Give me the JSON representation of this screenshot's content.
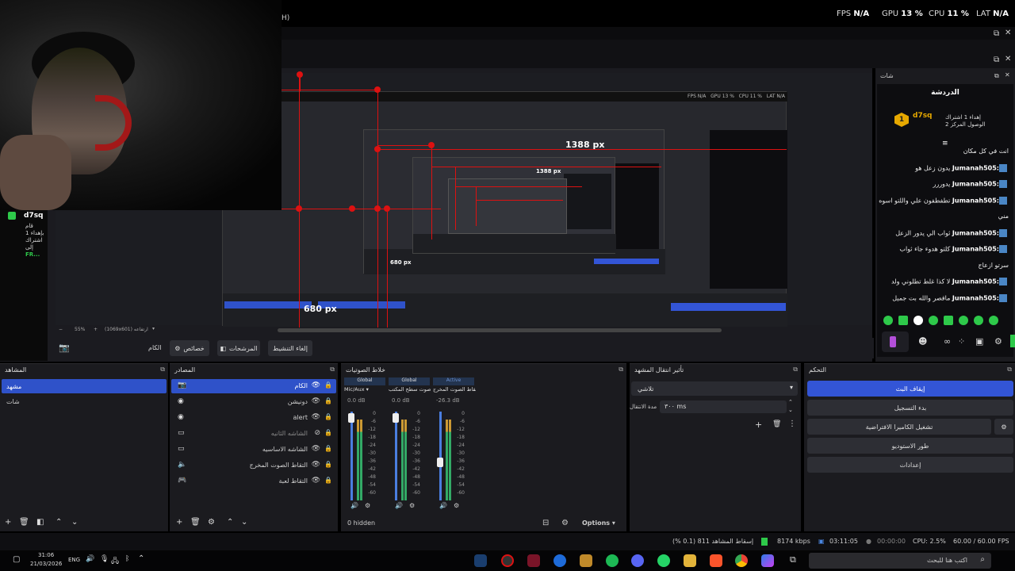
{
  "topbar": {
    "hint": "H)",
    "fps_label": "FPS",
    "fps_value": "N/A",
    "gpu_label": "GPU",
    "gpu_value": "13 %",
    "cpu_label": "CPU",
    "cpu_value": "11 %",
    "lat_label": "LAT",
    "lat_value": "N/A"
  },
  "webcam_overlay": {
    "name": "d7sq",
    "line1": "قام",
    "line2": "بإهداء 1",
    "line3": "اشتراك",
    "line4": "إلى",
    "line5": "FR..."
  },
  "preview": {
    "label_1388": "1388 px",
    "label_680": "680 px",
    "inner_1388": "1388 px",
    "zoom": "55%",
    "resolution": "(1069x601) ارتفاعه"
  },
  "context_bar": {
    "item_label": "الكام",
    "props_label": "خصائص",
    "filters_label": "المرشحات",
    "deactivate_label": "إلغاء التنشيط"
  },
  "chat": {
    "title": "شات",
    "heading": "الدردشة",
    "gifter": "d7sq",
    "gift_count": "1",
    "gift_text": "إهداء 1 اشتراك",
    "gift_sub": "الوصول المركز 2",
    "messages": [
      {
        "user": "",
        "text": "انت في كل مكان"
      },
      {
        "user": "Jumanah505:",
        "text": "يدون زعل هو"
      },
      {
        "user": "Jumanah505:",
        "text": "يدوررر"
      },
      {
        "user": "Jumanah505:",
        "text": "تطفطفون علي واللتو اسوه"
      },
      {
        "user": "",
        "text": "مني"
      },
      {
        "user": "Jumanah505:",
        "text": "ثواب الي يدور الزعل"
      },
      {
        "user": "Jumanah505:",
        "text": "كلتو هدوء جاء ثواب"
      },
      {
        "user": "",
        "text": "سرتو ازعاج"
      },
      {
        "user": "Jumanah505:",
        "text": "لا كذا غلط تطلوني ولد"
      },
      {
        "user": "Jumanah505:",
        "text": "ماقصر والله بت جميل"
      }
    ]
  },
  "scenes": {
    "title": "المشاهد",
    "items": [
      "مشهد",
      "شات"
    ],
    "selected": 0
  },
  "sources": {
    "title": "المصادر",
    "items": [
      {
        "label": "الكام",
        "icon": "camera-icon"
      },
      {
        "label": "دونيشن",
        "icon": "browser-icon"
      },
      {
        "label": "alert",
        "icon": "browser-icon"
      },
      {
        "label": "الشاشه الثانيه",
        "icon": "display-icon"
      },
      {
        "label": "الشاشه الاساسيه",
        "icon": "display-icon"
      },
      {
        "label": "التقاط الصوت المخرج",
        "icon": "speaker-icon"
      },
      {
        "label": "التقاط لعبة",
        "icon": "gamepad-icon"
      }
    ]
  },
  "mixer": {
    "title": "خلاط الصوتيات",
    "hidden": "0 hidden",
    "options": "Options",
    "channels": [
      {
        "tag": "Global",
        "name": "Mic/Aux",
        "db": "0.0 dB",
        "level": 0.95
      },
      {
        "tag": "Global",
        "name": "صوت سطح المكتب",
        "db": "0.0 dB",
        "level": 0.95
      },
      {
        "tag": "Active",
        "name": "التقاط الصوت المخرج",
        "db": "-26.3 dB",
        "level": 0.45
      }
    ],
    "scale": [
      "0",
      "-6",
      "-12",
      "-18",
      "-24",
      "-30",
      "-36",
      "-42",
      "-48",
      "-54",
      "-60"
    ]
  },
  "transitions": {
    "title": "تأثير انتقال المشهد",
    "type": "تلاشي",
    "duration_label": "مدة الانتقال",
    "duration": "٣٠٠ ms"
  },
  "controls": {
    "title": "التحكم",
    "stop_stream": "إيقاف البث",
    "start_record": "بدء التسجيل",
    "virtual_cam": "تشغيل الكاميرا الافتراضية",
    "studio": "طور الاستوديو",
    "settings": "إعدادات"
  },
  "status": {
    "dropped": "إسقاط المشاهد 811 (0.1 %)",
    "kbps": "8174 kbps",
    "stream_time": "03:11:05",
    "rec_time": "00:00:00",
    "cpu": "CPU: 2.5%",
    "fps": "60.00 / 60.00 FPS"
  },
  "taskbar": {
    "time": "31:06",
    "date": "21/03/2026",
    "lang": "ENG",
    "search": "اكتب هنا للبحث"
  },
  "colors": {
    "accent": "#3355d6",
    "red": "#dd1111",
    "green": "#2ec94a"
  }
}
